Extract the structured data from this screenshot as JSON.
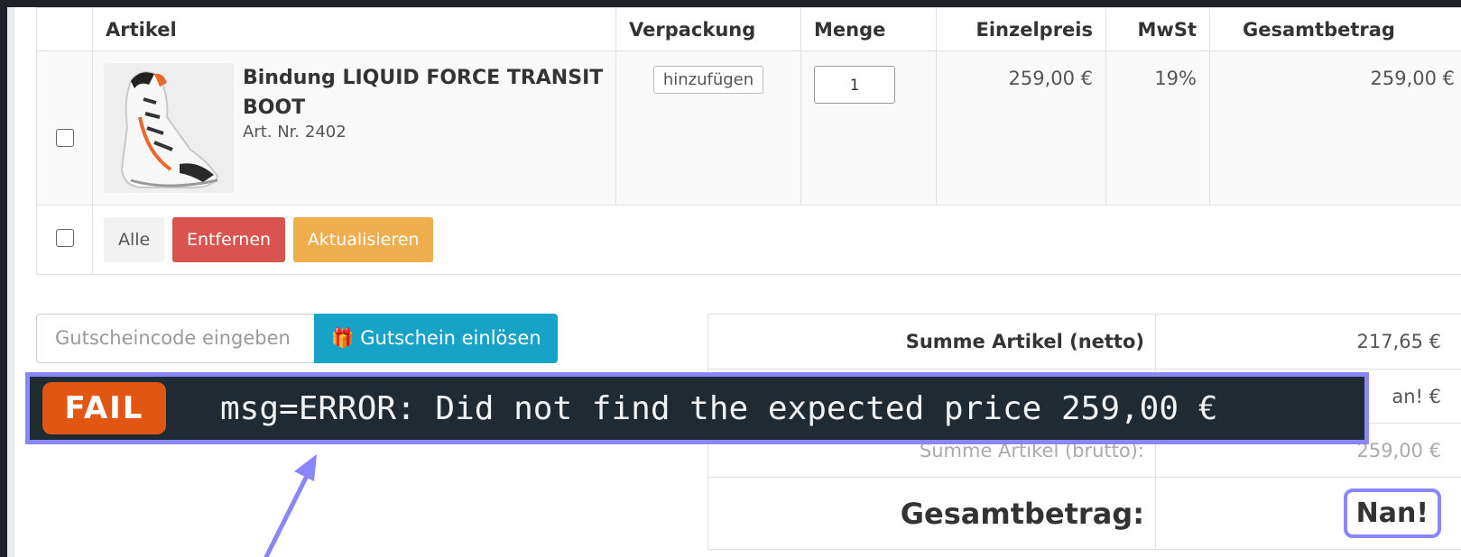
{
  "cart": {
    "headers": {
      "article": "Artikel",
      "packaging": "Verpackung",
      "quantity": "Menge",
      "unit_price": "Einzelpreis",
      "vat": "MwSt",
      "total": "Gesamtbetrag"
    },
    "item": {
      "name": "Bindung LIQUID FORCE TRANSIT BOOT",
      "sku": "Art. Nr. 2402",
      "packaging_button": "hinzufügen",
      "quantity": "1",
      "unit_price": "259,00 €",
      "vat": "19%",
      "total": "259,00 €"
    },
    "actions": {
      "all": "Alle",
      "remove": "Entfernen",
      "update": "Aktualisieren"
    }
  },
  "voucher": {
    "placeholder": "Gutscheincode eingeben",
    "button": "Gutschein einlösen"
  },
  "summary": {
    "net_label": "Summe Artikel (netto)",
    "net_value": "217,65 €",
    "mid_value_partial": "an! €",
    "gross_label_partial": "Summe Artikel (brutto):",
    "gross_value_partial": "259,00 €",
    "total_label": "Gesamtbetrag:",
    "total_value": "Nan!"
  },
  "overlay": {
    "badge": "FAIL",
    "message": "msg=ERROR: Did not find the expected price 259,00 €"
  },
  "colors": {
    "accent_outline": "#8a86ff",
    "fail_badge": "#e15612",
    "remove_button": "#d9534f",
    "update_button": "#f0ad4e",
    "voucher_button": "#17a2c8"
  }
}
